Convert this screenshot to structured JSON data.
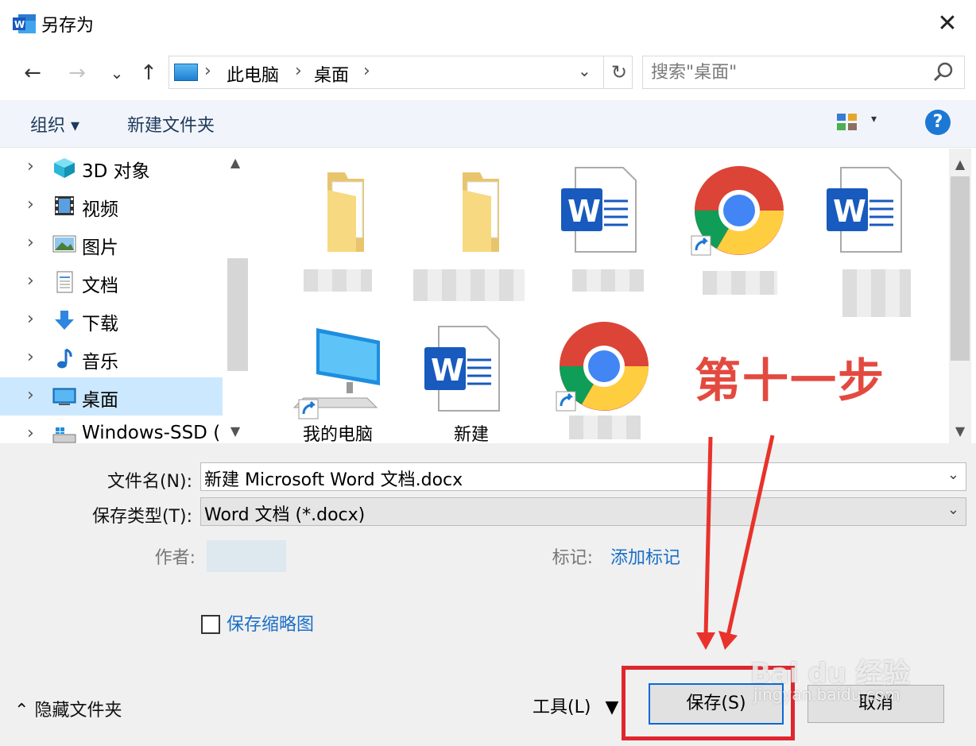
{
  "window": {
    "title": "另存为",
    "close_label": "✕"
  },
  "nav": {
    "back": "←",
    "forward": "→",
    "recent": "⌄",
    "up": "↑",
    "breadcrumbs": [
      "此电脑",
      "桌面"
    ],
    "refresh": "↻",
    "search_placeholder": "搜索\"桌面\""
  },
  "toolbar": {
    "organize_label": "组织 ▾",
    "new_folder_label": "新建文件夹",
    "help_label": "?"
  },
  "sidebar": {
    "items": [
      {
        "label": "3D 对象",
        "icon": "3d-objects-icon"
      },
      {
        "label": "视频",
        "icon": "video-icon"
      },
      {
        "label": "图片",
        "icon": "pictures-icon"
      },
      {
        "label": "文档",
        "icon": "documents-icon"
      },
      {
        "label": "下载",
        "icon": "downloads-icon"
      },
      {
        "label": "音乐",
        "icon": "music-icon"
      },
      {
        "label": "桌面",
        "icon": "desktop-icon",
        "selected": true
      },
      {
        "label": "Windows-SSD (",
        "icon": "drive-icon"
      }
    ]
  },
  "files": {
    "visible_labels": [
      "我的电脑",
      "新建"
    ],
    "annotation": "第十一步"
  },
  "form": {
    "filename_label": "文件名(N):",
    "filename_value": "新建 Microsoft Word 文档.docx",
    "type_label": "保存类型(T):",
    "type_value": "Word 文档 (*.docx)",
    "author_label": "作者:",
    "tags_label": "标记:",
    "tags_link": "添加标记",
    "thumbnail_label": "保存缩略图"
  },
  "footer": {
    "hide_folders_label": "隐藏文件夹",
    "tools_label": "工具(L)",
    "save_label": "保存(S)",
    "cancel_label": "取消"
  },
  "watermark": {
    "line1": "Bai du 经验",
    "line2": "jingyan.baidu.com"
  },
  "colors": {
    "accent": "#1d78d4",
    "selection": "#cce8ff",
    "annotation_red": "#e0262d"
  }
}
